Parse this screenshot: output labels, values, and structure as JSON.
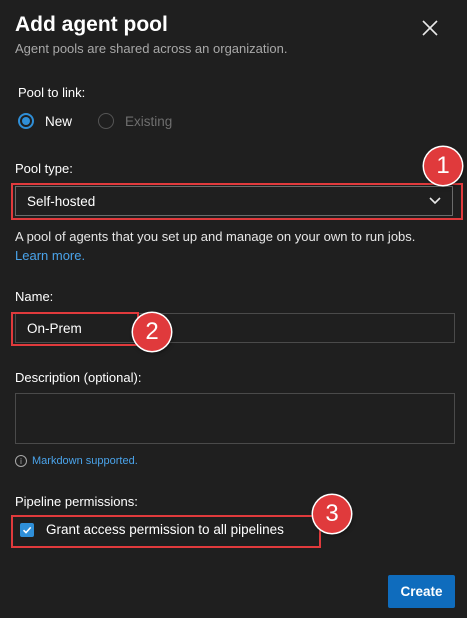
{
  "dialog": {
    "title": "Add agent pool",
    "subtitle": "Agent pools are shared across an organization."
  },
  "pool_to_link": {
    "label": "Pool to link:",
    "options": [
      "New",
      "Existing"
    ],
    "selected": "New"
  },
  "pool_type": {
    "label": "Pool type:",
    "value": "Self-hosted",
    "help_text": "A pool of agents that you set up and manage on your own to run jobs.",
    "learn_more": "Learn more."
  },
  "name": {
    "label": "Name:",
    "value": "On-Prem"
  },
  "description": {
    "label": "Description (optional):",
    "value": "",
    "markdown_note": "Markdown supported."
  },
  "pipeline_permissions": {
    "label": "Pipeline permissions:",
    "checkbox_label": "Grant access permission to all pipelines",
    "checked": true
  },
  "actions": {
    "create_label": "Create"
  },
  "callouts": [
    "1",
    "2",
    "3"
  ],
  "colors": {
    "background": "#1f1f1f",
    "accent": "#2f8fd8",
    "primary_button": "#0f6cbd",
    "highlight": "#e03a3c",
    "link": "#4aa3ea"
  },
  "icons": {
    "close": "close-icon",
    "dropdown": "chevron-down-icon",
    "info": "info-icon",
    "checkmark": "checkmark-icon"
  }
}
